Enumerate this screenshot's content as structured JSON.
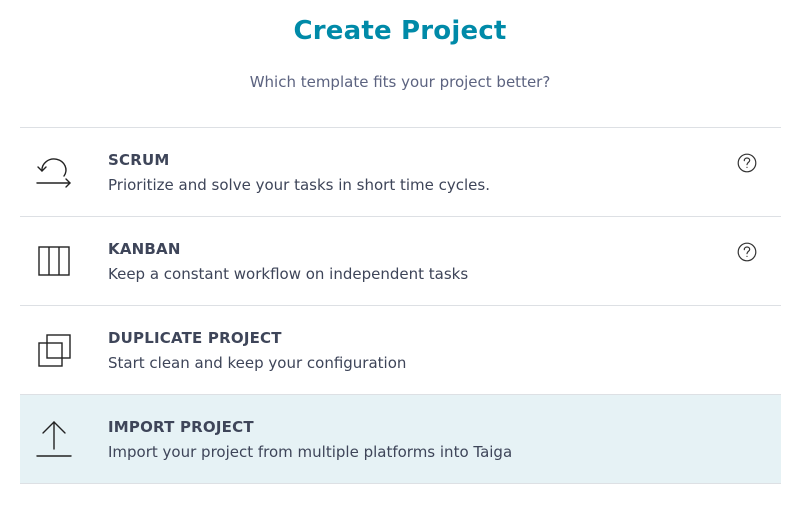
{
  "header": {
    "title": "Create Project",
    "subtitle": "Which template fits your project better?"
  },
  "options": [
    {
      "name": "SCRUM",
      "description": "Prioritize and solve your tasks in short time cycles.",
      "icon": "cycle-arrow-icon",
      "has_help": true
    },
    {
      "name": "KANBAN",
      "description": "Keep a constant workflow on independent tasks",
      "icon": "columns-icon",
      "has_help": true
    },
    {
      "name": "DUPLICATE PROJECT",
      "description": "Start clean and keep your configuration",
      "icon": "duplicate-icon",
      "has_help": false
    },
    {
      "name": "IMPORT PROJECT",
      "description": "Import your project from multiple platforms into Taiga",
      "icon": "upload-icon",
      "has_help": false,
      "highlighted": true
    }
  ],
  "colors": {
    "accent": "#008aa8",
    "highlight_bg": "#e6f2f5",
    "divider": "#dde0e4",
    "text": "#3e4559"
  }
}
